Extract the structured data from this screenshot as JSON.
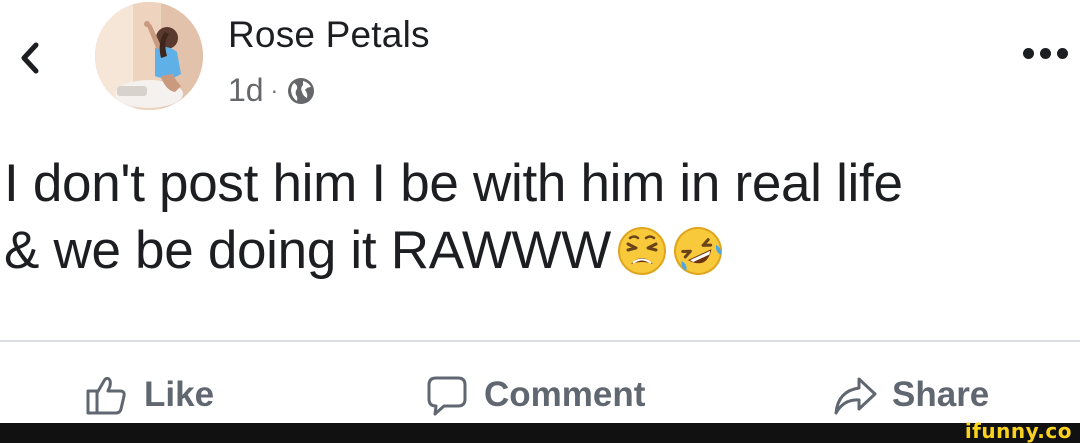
{
  "post": {
    "author": "Rose Petals",
    "time": "1d",
    "separator": "·",
    "privacy_icon": "globe-icon",
    "text_line_1": "I don't post him I be with him in real life",
    "text_line_2": "& we be doing it RAWWW",
    "emojis": [
      "weary-face-emoji",
      "rolling-on-floor-laughing-emoji"
    ]
  },
  "actions": {
    "like": "Like",
    "comment": "Comment",
    "share": "Share"
  },
  "icons": {
    "back": "chevron-left-icon",
    "more": "more-options-icon",
    "like": "thumbs-up-icon",
    "comment": "speech-bubble-icon",
    "share": "share-arrow-icon"
  },
  "watermark": {
    "text": "ifunny.co"
  },
  "colors": {
    "text_primary": "#1c1e21",
    "text_secondary": "#65676b",
    "action_text": "#606770",
    "divider": "#dadde1",
    "watermark": "#f8d21c",
    "bottom_bar": "#111111"
  }
}
